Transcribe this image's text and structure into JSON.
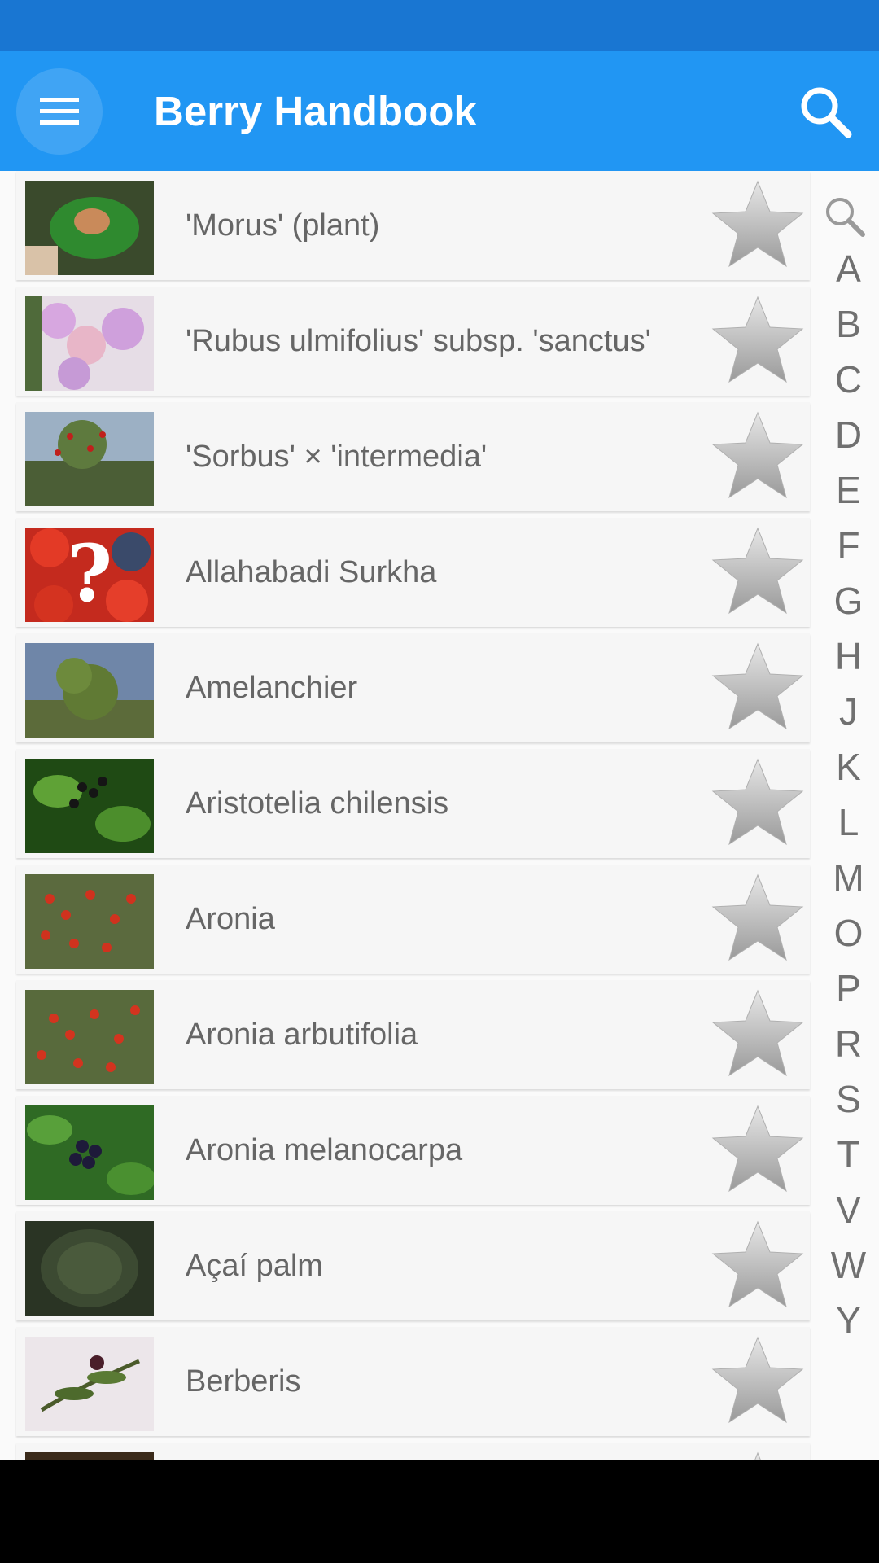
{
  "app": {
    "title": "Berry Handbook"
  },
  "header": {
    "menu_icon": "hamburger-menu-icon",
    "search_icon": "search-icon"
  },
  "items": [
    {
      "name": "'Morus' (plant)"
    },
    {
      "name": "'Rubus ulmifolius' subsp. 'sanctus'"
    },
    {
      "name": "'Sorbus' × 'intermedia'"
    },
    {
      "name": "Allahabadi Surkha"
    },
    {
      "name": "Amelanchier"
    },
    {
      "name": "Aristotelia chilensis"
    },
    {
      "name": "Aronia"
    },
    {
      "name": "Aronia arbutifolia"
    },
    {
      "name": "Aronia melanocarpa"
    },
    {
      "name": "Açaí palm"
    },
    {
      "name": "Berberis"
    }
  ],
  "alphabet_index": [
    "A",
    "B",
    "C",
    "D",
    "E",
    "F",
    "G",
    "H",
    "J",
    "K",
    "L",
    "M",
    "O",
    "P",
    "R",
    "S",
    "T",
    "V",
    "W",
    "Y"
  ],
  "colors": {
    "status_bar": "#1976d2",
    "app_bar": "#2196f3",
    "list_bg": "#fafafa",
    "text": "#666666"
  }
}
